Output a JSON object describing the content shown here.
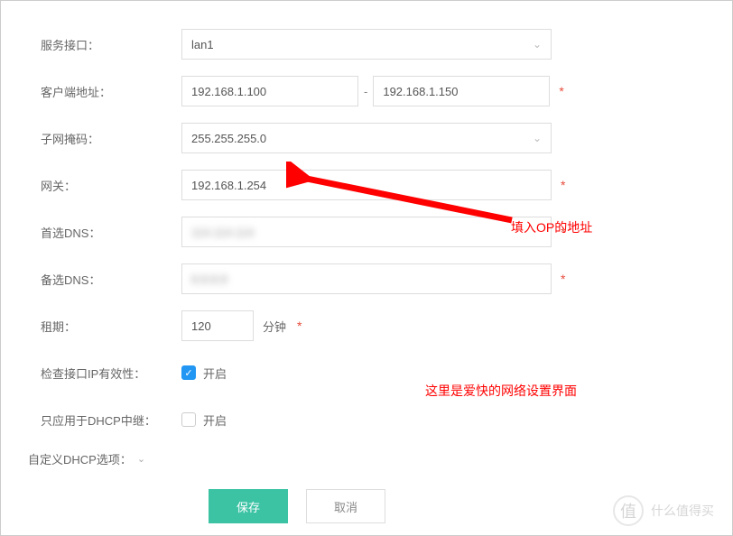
{
  "labels": {
    "service_interface": "服务接口：",
    "client_address": "客户端地址：",
    "subnet_mask": "子网掩码：",
    "gateway": "网关：",
    "primary_dns": "首选DNS：",
    "secondary_dns": "备选DNS：",
    "lease": "租期：",
    "check_validity": "检查接口IP有效性：",
    "dhcp_relay_only": "只应用于DHCP中继：",
    "custom_dhcp": "自定义DHCP选项："
  },
  "values": {
    "service_interface": "lan1",
    "client_start": "192.168.1.100",
    "client_end": "192.168.1.150",
    "subnet_mask": "255.255.255.0",
    "gateway": "192.168.1.254",
    "primary_dns": "",
    "secondary_dns": "",
    "lease": "120",
    "lease_unit": "分钟",
    "enable_label": "开启"
  },
  "buttons": {
    "save": "保存",
    "cancel": "取消"
  },
  "annotations": {
    "arrow_text": "填入OP的地址",
    "note": "这里是爱快的网络设置界面"
  },
  "watermark": {
    "logo": "值",
    "text": "什么值得买"
  },
  "asterisk": "*"
}
